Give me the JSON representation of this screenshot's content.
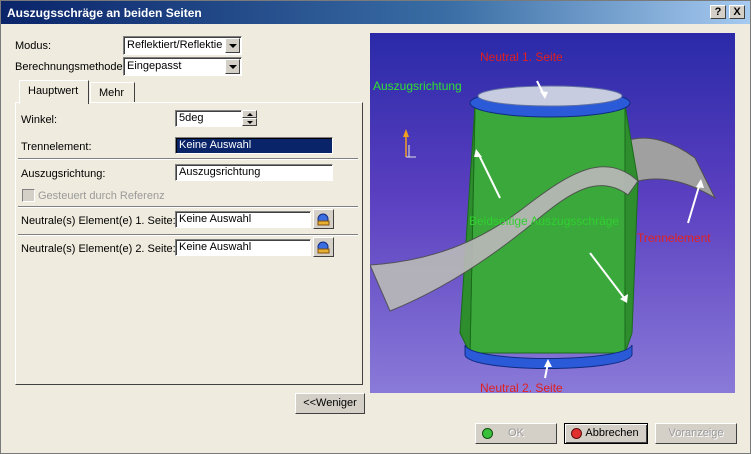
{
  "window": {
    "title": "Auszugsschräge an beiden Seiten",
    "help_label": "?",
    "close_label": "X"
  },
  "form": {
    "modus_label": "Modus:",
    "modus_value": "Reflektiert/Reflektiert",
    "berechnung_label": "Berechnungsmethode:",
    "berechnung_value": "Eingepasst"
  },
  "tabs": [
    {
      "label": "Hauptwert",
      "active": true
    },
    {
      "label": "Mehr",
      "active": false
    }
  ],
  "panel": {
    "winkel_label": "Winkel:",
    "winkel_value": "5deg",
    "trennelement_label": "Trennelement:",
    "trennelement_value": "Keine Auswahl",
    "auszugsrichtung_label": "Auszugsrichtung:",
    "auszugsrichtung_value": "Auszugsrichtung",
    "gesteuert_label": "Gesteuert durch Referenz",
    "neutral1_label": "Neutrale(s) Element(e) 1. Seite:",
    "neutral1_value": "Keine Auswahl",
    "neutral2_label": "Neutrale(s) Element(e) 2. Seite:",
    "neutral2_value": "Keine Auswahl"
  },
  "buttons": {
    "weniger": "<<Weniger",
    "ok": "OK",
    "abbrechen": "Abbrechen",
    "voranzeige": "Voranzeige"
  },
  "viewport": {
    "neutral1": "Neutral 1. Seite",
    "auszugsrichtung": "Auszugsrichtung",
    "schaege": "Beidseitige Auszugsschräge",
    "trennelement": "Trennelement",
    "neutral2": "Neutral 2. Seite"
  },
  "colors": {
    "annotation_red": "#e02020",
    "annotation_green": "#30e030",
    "shape_green": "#3aa83a",
    "shape_blue": "#2a5ad8"
  }
}
